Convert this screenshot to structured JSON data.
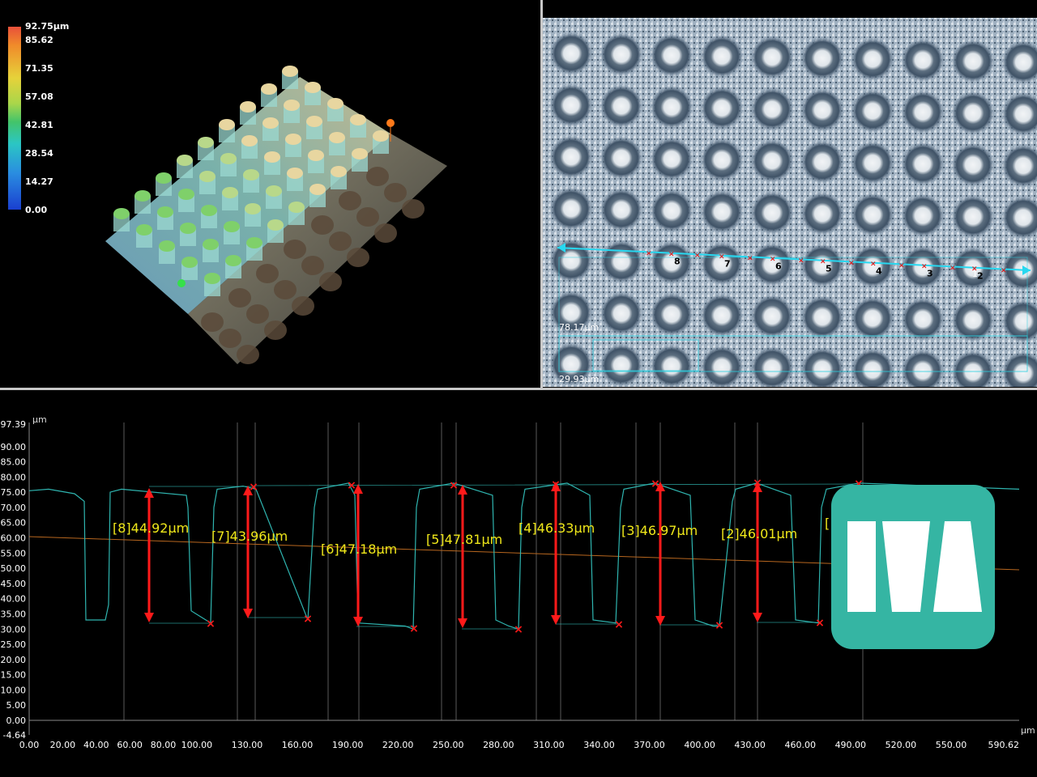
{
  "colorscale": {
    "labels": [
      "92.75µm",
      "85.62",
      "71.35",
      "57.08",
      "42.81",
      "28.54",
      "14.27",
      "0.00"
    ]
  },
  "photo": {
    "markers": [
      "8",
      "7",
      "6",
      "5",
      "4",
      "3",
      "2",
      "1"
    ],
    "dim_top": "78.17µm",
    "dim_bottom": "29.93µm"
  },
  "profile": {
    "y_unit": "µm",
    "x_unit": "µm",
    "y_max_label": "97.39",
    "y_min_label": "-4.64",
    "y_ticks": [
      "90.00",
      "85.00",
      "80.00",
      "75.00",
      "70.00",
      "65.00",
      "60.00",
      "55.00",
      "50.00",
      "45.00",
      "40.00",
      "35.00",
      "30.00",
      "25.00",
      "20.00",
      "15.00",
      "10.00",
      "5.00",
      "0.00"
    ],
    "x_ticks": [
      "0.00",
      "20.00",
      "40.00",
      "60.00",
      "80.00",
      "100.00",
      "130.00",
      "160.00",
      "190.00",
      "220.00",
      "250.00",
      "280.00",
      "310.00",
      "340.00",
      "370.00",
      "400.00",
      "430.00",
      "460.00",
      "490.00",
      "520.00",
      "550.00"
    ],
    "x_max_label": "590.62",
    "measurements": [
      "[8]44.92µm",
      "[7]43.96µm",
      "[6]47.18µm",
      "[5]47.81µm",
      "[4]46.33µm",
      "[3]46.97µm",
      "[2]46.01µm",
      "["
    ],
    "colors": {
      "profile": "#2fb5b0",
      "arrow": "#ff1a1a",
      "label": "#f0e81a",
      "trend": "#b8671f",
      "grid": "#5a5a5a"
    }
  },
  "logo": {
    "color": "#35b5a3"
  }
}
